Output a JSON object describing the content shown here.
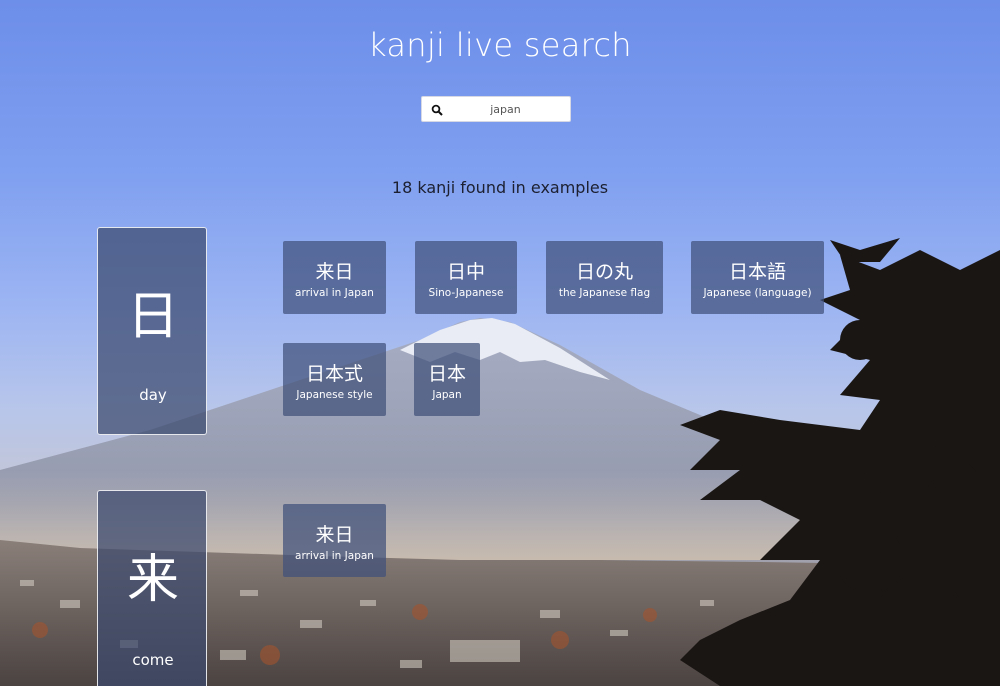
{
  "header": {
    "title": "kanji live search"
  },
  "search": {
    "value": "japan",
    "icon": "search-icon"
  },
  "results": {
    "count_text": "18 kanji found in examples"
  },
  "kanji": [
    {
      "glyph": "日",
      "meaning": "day",
      "examples": [
        {
          "word": "来日",
          "translation": "arrival in Japan"
        },
        {
          "word": "日中",
          "translation": "Sino-Japanese"
        },
        {
          "word": "日の丸",
          "translation": "the Japanese flag"
        },
        {
          "word": "日本語",
          "translation": "Japanese (language)"
        },
        {
          "word": "日本式",
          "translation": "Japanese style"
        },
        {
          "word": "日本",
          "translation": "Japan"
        }
      ]
    },
    {
      "glyph": "来",
      "meaning": "come",
      "examples": [
        {
          "word": "来日",
          "translation": "arrival in Japan"
        }
      ]
    }
  ],
  "colors": {
    "card": "#3c4a6e",
    "text": "#ffffff",
    "sky": "#6d8ee9"
  }
}
